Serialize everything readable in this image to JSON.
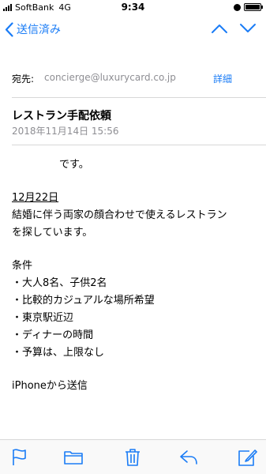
{
  "status_bar": {
    "carrier": "SoftBank",
    "network": "4G",
    "time": "9:34"
  },
  "nav": {
    "back_label": "送信済み"
  },
  "email": {
    "recipient_label": "宛先:",
    "recipient": "concierge@luxurycard.co.jp",
    "details_label": "詳細",
    "subject": "レストラン手配依頼",
    "date": "2018年11月14日 15:56",
    "body": {
      "greeting_suffix": "です。",
      "date_line": "12月22日",
      "request_lines": [
        "結婚に伴う両家の顔合わせで使えるレストラン",
        "を探しています。"
      ],
      "conditions_title": "条件",
      "conditions": [
        "・大人8名、子供2名",
        "・比較的カジュアルな場所希望",
        "・東京駅近辺",
        "・ディナーの時間",
        "・予算は、上限なし"
      ],
      "signature": "iPhoneから送信"
    }
  },
  "colors": {
    "accent": "#1a7cf6",
    "secondary_text": "#8e8e93"
  }
}
